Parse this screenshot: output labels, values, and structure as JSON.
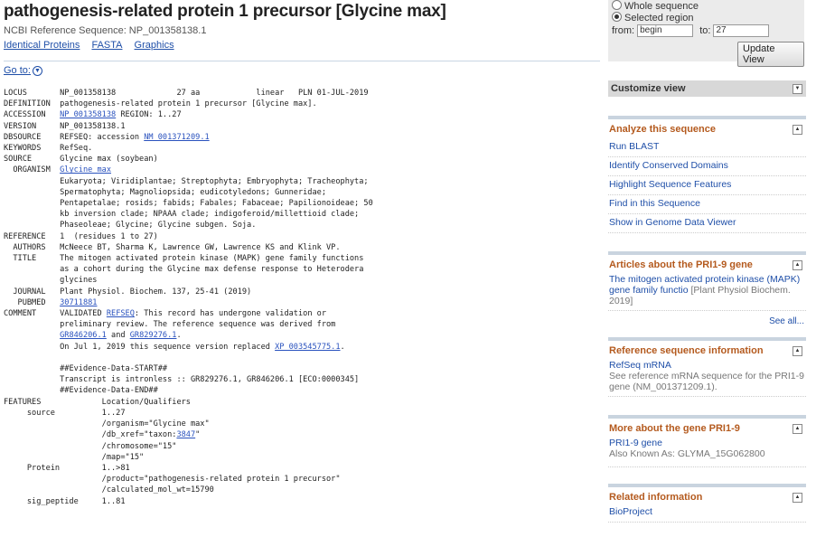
{
  "header": {
    "title": "pathogenesis-related protein 1 precursor [Glycine max]",
    "refseq": "NCBI Reference Sequence: NP_001358138.1",
    "links": [
      "Identical Proteins",
      "FASTA",
      "Graphics"
    ],
    "goto": "Go to:"
  },
  "genbank": {
    "locus_line": "NP_001358138             27 aa            linear   PLN 01-JUL-2019",
    "definition": "pathogenesis-related protein 1 precursor [Glycine max].",
    "accession_link": "NP_001358138",
    "accession_rest": " REGION: 1..27",
    "version": "NP_001358138.1",
    "dbsource_pre": "REFSEQ: accession ",
    "dbsource_link": "NM_001371209.1",
    "keywords": "RefSeq.",
    "source": "Glycine max (soybean)",
    "organism_link": "Glycine max",
    "taxonomy": [
      "Eukaryota; Viridiplantae; Streptophyta; Embryophyta; Tracheophyta;",
      "Spermatophyta; Magnoliopsida; eudicotyledons; Gunneridae;",
      "Pentapetalae; rosids; fabids; Fabales; Fabaceae; Papilionoideae; 50",
      "kb inversion clade; NPAAA clade; indigoferoid/millettioid clade;",
      "Phaseoleae; Glycine; Glycine subgen. Soja."
    ],
    "reference": "1  (residues 1 to 27)",
    "authors": "McNeece BT, Sharma K, Lawrence GW, Lawrence KS and Klink VP.",
    "title_lines": [
      "The mitogen activated protein kinase (MAPK) gene family functions",
      "as a cohort during the Glycine max defense response to Heterodera",
      "glycines"
    ],
    "journal": "Plant Physiol. Biochem. 137, 25-41 (2019)",
    "pubmed_link": "30711881",
    "comment_pre": "VALIDATED ",
    "comment_link_refseq": "REFSEQ",
    "comment_l1_post": ": This record has undergone validation or",
    "comment_l2": "preliminary review. The reference sequence was derived from",
    "comment_link_gr1": "GR846206.1",
    "comment_and": " and ",
    "comment_link_gr2": "GR829276.1",
    "comment_l3_end": ".",
    "comment_l4_pre": "On Jul 1, 2019 this sequence version replaced ",
    "comment_link_xp": "XP_003545775.1",
    "comment_l4_end": ".",
    "evidence_start": "##Evidence-Data-START##",
    "evidence_line": "Transcript is intronless :: GR829276.1, GR846206.1 [ECO:0000345]",
    "evidence_end": "##Evidence-Data-END##",
    "features_header": "Location/Qualifiers",
    "source_loc": "1..27",
    "source_organism": "/organism=\"Glycine max\"",
    "source_dbxref_pre": "/db_xref=\"taxon:",
    "source_dbxref_link": "3847",
    "source_dbxref_post": "\"",
    "source_chromosome": "/chromosome=\"15\"",
    "source_map": "/map=\"15\"",
    "protein_loc": "1..>81",
    "protein_product": "/product=\"pathogenesis-related protein 1 precursor\"",
    "protein_mw": "/calculated_mol_wt=15790",
    "sigpep_loc": "1..81"
  },
  "view": {
    "whole": "Whole sequence",
    "selected": "Selected region",
    "from_label": "from:",
    "from_value": "begin",
    "to_label": "to:",
    "to_value": "27",
    "update": "Update View"
  },
  "customize": {
    "label": "Customize view"
  },
  "analyze": {
    "title": "Analyze this sequence",
    "items": [
      "Run BLAST",
      "Identify Conserved Domains",
      "Highlight Sequence Features",
      "Find in this Sequence",
      "Show in Genome Data Viewer"
    ]
  },
  "articles": {
    "title": "Articles about the PRI1-9 gene",
    "link": "The mitogen activated protein kinase (MAPK) gene family functio",
    "cite": "[Plant Physiol Biochem. 2019]",
    "see_all": "See all..."
  },
  "refinfo": {
    "title": "Reference sequence information",
    "link": "RefSeq mRNA",
    "desc": "See reference mRNA sequence for the PRI1-9 gene (NM_001371209.1)."
  },
  "moregene": {
    "title": "More about the gene PRI1-9",
    "link": "PRI1-9 gene",
    "desc": "Also Known As: GLYMA_15G062800"
  },
  "related": {
    "title": "Related information",
    "link": "BioProject"
  },
  "colors": {
    "link": "#1f4fa8",
    "panel_title": "#b45a1e",
    "bar": "#c9d4df"
  }
}
